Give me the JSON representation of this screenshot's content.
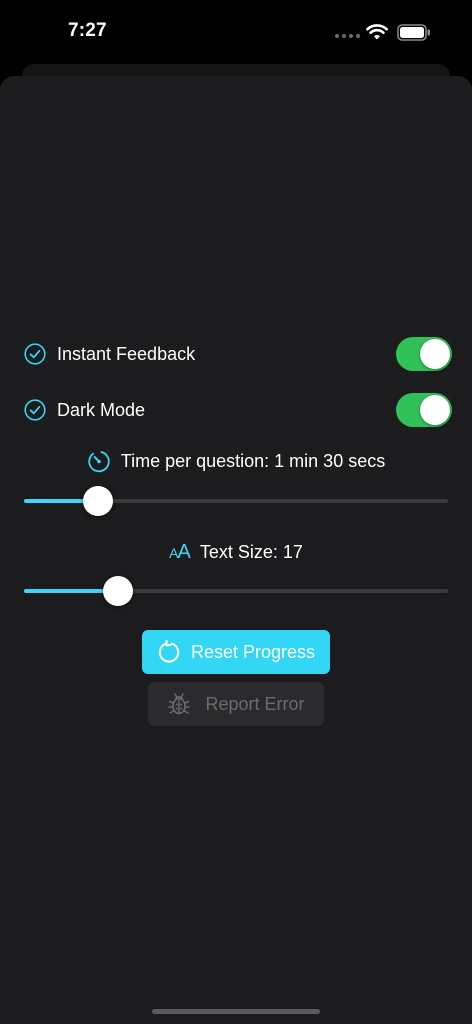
{
  "status_bar": {
    "time": "7:27",
    "icons": [
      "signal-dots-icon",
      "wifi-icon",
      "battery-icon"
    ]
  },
  "settings": {
    "instant_feedback": {
      "label": "Instant Feedback",
      "checked": true,
      "toggle_on": true
    },
    "dark_mode": {
      "label": "Dark Mode",
      "checked": true,
      "toggle_on": true
    },
    "time_per_question": {
      "label": "Time per question: 1 min 30 secs",
      "slider_fraction": 0.15
    },
    "text_size": {
      "icon_text_small": "A",
      "icon_text_large": "A",
      "label": "Text Size: 17",
      "slider_fraction": 0.2
    }
  },
  "actions": {
    "reset_label": "Reset Progress",
    "report_label": "Report Error",
    "report_enabled": false
  },
  "colors": {
    "accent": "#33d6f5",
    "toggle_on": "#30c158",
    "background": "#1c1c1e",
    "disabled_text": "#6b6b6d"
  }
}
